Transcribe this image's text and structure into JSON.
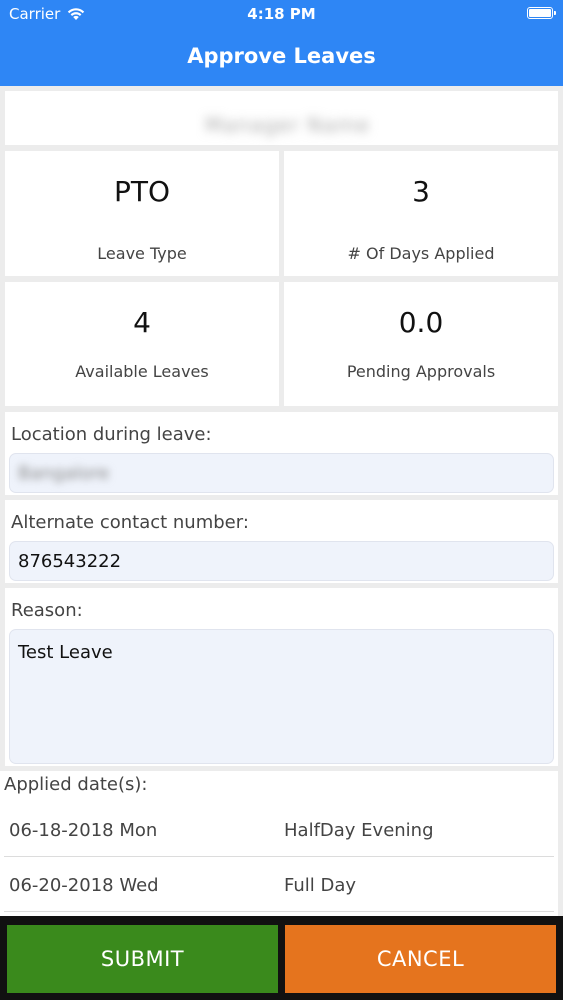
{
  "status_bar": {
    "carrier": "Carrier",
    "time": "4:18 PM"
  },
  "nav": {
    "title": "Approve Leaves"
  },
  "employee": {
    "name": "Manager Name"
  },
  "summary": {
    "leave_type_value": "PTO",
    "leave_type_label": "Leave Type",
    "days_applied_value": "3",
    "days_applied_label": "# Of Days Applied",
    "available_value": "4",
    "available_label": "Available Leaves",
    "pending_value": "0.0",
    "pending_label": "Pending Approvals"
  },
  "form": {
    "location_label": "Location during leave:",
    "location_value": "Bangalore",
    "contact_label": "Alternate contact number:",
    "contact_value": "876543222",
    "reason_label": "Reason:",
    "reason_value": "Test Leave"
  },
  "applied_dates": {
    "label": "Applied date(s):",
    "rows": [
      {
        "date": "06-18-2018 Mon",
        "type": "HalfDay Evening"
      },
      {
        "date": "06-20-2018 Wed",
        "type": "Full Day"
      }
    ]
  },
  "actions": {
    "submit_label": "SUBMIT",
    "cancel_label": "CANCEL"
  },
  "colors": {
    "header": "#2e86f5",
    "submit": "#3a8a1c",
    "cancel": "#e5741e"
  }
}
